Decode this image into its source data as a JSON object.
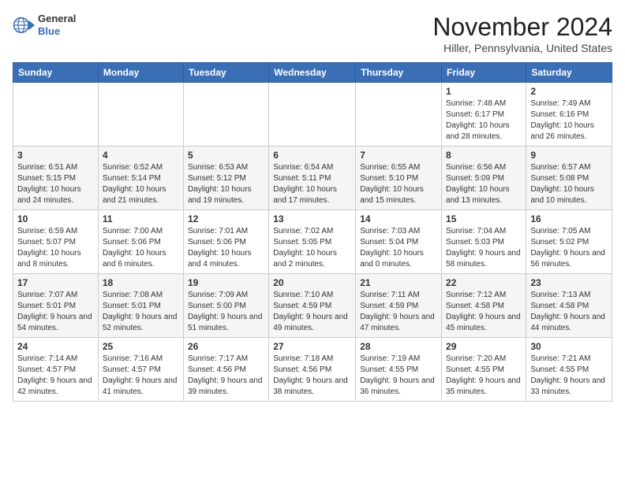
{
  "logo": {
    "general": "General",
    "blue": "Blue"
  },
  "header": {
    "month": "November 2024",
    "location": "Hiller, Pennsylvania, United States"
  },
  "days_of_week": [
    "Sunday",
    "Monday",
    "Tuesday",
    "Wednesday",
    "Thursday",
    "Friday",
    "Saturday"
  ],
  "weeks": [
    [
      {
        "day": "",
        "info": ""
      },
      {
        "day": "",
        "info": ""
      },
      {
        "day": "",
        "info": ""
      },
      {
        "day": "",
        "info": ""
      },
      {
        "day": "",
        "info": ""
      },
      {
        "day": "1",
        "info": "Sunrise: 7:48 AM\nSunset: 6:17 PM\nDaylight: 10 hours and 28 minutes."
      },
      {
        "day": "2",
        "info": "Sunrise: 7:49 AM\nSunset: 6:16 PM\nDaylight: 10 hours and 26 minutes."
      }
    ],
    [
      {
        "day": "3",
        "info": "Sunrise: 6:51 AM\nSunset: 5:15 PM\nDaylight: 10 hours and 24 minutes."
      },
      {
        "day": "4",
        "info": "Sunrise: 6:52 AM\nSunset: 5:14 PM\nDaylight: 10 hours and 21 minutes."
      },
      {
        "day": "5",
        "info": "Sunrise: 6:53 AM\nSunset: 5:12 PM\nDaylight: 10 hours and 19 minutes."
      },
      {
        "day": "6",
        "info": "Sunrise: 6:54 AM\nSunset: 5:11 PM\nDaylight: 10 hours and 17 minutes."
      },
      {
        "day": "7",
        "info": "Sunrise: 6:55 AM\nSunset: 5:10 PM\nDaylight: 10 hours and 15 minutes."
      },
      {
        "day": "8",
        "info": "Sunrise: 6:56 AM\nSunset: 5:09 PM\nDaylight: 10 hours and 13 minutes."
      },
      {
        "day": "9",
        "info": "Sunrise: 6:57 AM\nSunset: 5:08 PM\nDaylight: 10 hours and 10 minutes."
      }
    ],
    [
      {
        "day": "10",
        "info": "Sunrise: 6:59 AM\nSunset: 5:07 PM\nDaylight: 10 hours and 8 minutes."
      },
      {
        "day": "11",
        "info": "Sunrise: 7:00 AM\nSunset: 5:06 PM\nDaylight: 10 hours and 6 minutes."
      },
      {
        "day": "12",
        "info": "Sunrise: 7:01 AM\nSunset: 5:06 PM\nDaylight: 10 hours and 4 minutes."
      },
      {
        "day": "13",
        "info": "Sunrise: 7:02 AM\nSunset: 5:05 PM\nDaylight: 10 hours and 2 minutes."
      },
      {
        "day": "14",
        "info": "Sunrise: 7:03 AM\nSunset: 5:04 PM\nDaylight: 10 hours and 0 minutes."
      },
      {
        "day": "15",
        "info": "Sunrise: 7:04 AM\nSunset: 5:03 PM\nDaylight: 9 hours and 58 minutes."
      },
      {
        "day": "16",
        "info": "Sunrise: 7:05 AM\nSunset: 5:02 PM\nDaylight: 9 hours and 56 minutes."
      }
    ],
    [
      {
        "day": "17",
        "info": "Sunrise: 7:07 AM\nSunset: 5:01 PM\nDaylight: 9 hours and 54 minutes."
      },
      {
        "day": "18",
        "info": "Sunrise: 7:08 AM\nSunset: 5:01 PM\nDaylight: 9 hours and 52 minutes."
      },
      {
        "day": "19",
        "info": "Sunrise: 7:09 AM\nSunset: 5:00 PM\nDaylight: 9 hours and 51 minutes."
      },
      {
        "day": "20",
        "info": "Sunrise: 7:10 AM\nSunset: 4:59 PM\nDaylight: 9 hours and 49 minutes."
      },
      {
        "day": "21",
        "info": "Sunrise: 7:11 AM\nSunset: 4:59 PM\nDaylight: 9 hours and 47 minutes."
      },
      {
        "day": "22",
        "info": "Sunrise: 7:12 AM\nSunset: 4:58 PM\nDaylight: 9 hours and 45 minutes."
      },
      {
        "day": "23",
        "info": "Sunrise: 7:13 AM\nSunset: 4:58 PM\nDaylight: 9 hours and 44 minutes."
      }
    ],
    [
      {
        "day": "24",
        "info": "Sunrise: 7:14 AM\nSunset: 4:57 PM\nDaylight: 9 hours and 42 minutes."
      },
      {
        "day": "25",
        "info": "Sunrise: 7:16 AM\nSunset: 4:57 PM\nDaylight: 9 hours and 41 minutes."
      },
      {
        "day": "26",
        "info": "Sunrise: 7:17 AM\nSunset: 4:56 PM\nDaylight: 9 hours and 39 minutes."
      },
      {
        "day": "27",
        "info": "Sunrise: 7:18 AM\nSunset: 4:56 PM\nDaylight: 9 hours and 38 minutes."
      },
      {
        "day": "28",
        "info": "Sunrise: 7:19 AM\nSunset: 4:55 PM\nDaylight: 9 hours and 36 minutes."
      },
      {
        "day": "29",
        "info": "Sunrise: 7:20 AM\nSunset: 4:55 PM\nDaylight: 9 hours and 35 minutes."
      },
      {
        "day": "30",
        "info": "Sunrise: 7:21 AM\nSunset: 4:55 PM\nDaylight: 9 hours and 33 minutes."
      }
    ]
  ]
}
